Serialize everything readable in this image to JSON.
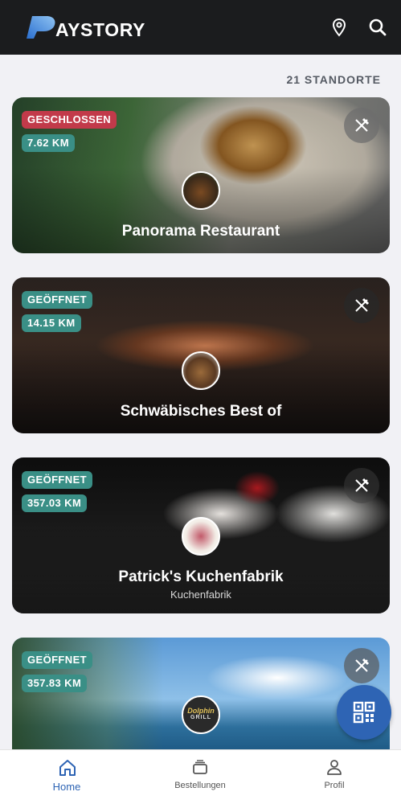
{
  "app": {
    "logo_text": "AYSTORY",
    "brand_color": "#3f86d8"
  },
  "header": {
    "icons": [
      "location-pin-icon",
      "search-icon"
    ]
  },
  "locations": {
    "count_label": "21 STANDORTE"
  },
  "cards": [
    {
      "status": "GESCHLOSSEN",
      "status_color": "#c23a4a",
      "distance": "7.62 KM",
      "title": "Panorama Restaurant",
      "subtitle": "",
      "icon": "knife-fork-icon"
    },
    {
      "status": "GEÖFFNET",
      "status_color": "#3a8f86",
      "distance": "14.15 KM",
      "title": "Schwäbisches Best of",
      "subtitle": "",
      "icon": "knife-fork-icon"
    },
    {
      "status": "GEÖFFNET",
      "status_color": "#3a8f86",
      "distance": "357.03 KM",
      "title": "Patrick's Kuchenfabrik",
      "subtitle": "Kuchenfabrik",
      "icon": "knife-fork-icon"
    },
    {
      "status": "GEÖFFNET",
      "status_color": "#3a8f86",
      "distance": "357.83 KM",
      "title": "",
      "subtitle": "",
      "icon": "knife-fork-icon",
      "avatar_text_top": "Dolphin",
      "avatar_text_bottom": "GRILL"
    }
  ],
  "fab": {
    "icon": "qr-code-icon"
  },
  "bottom_nav": [
    {
      "label": "Home",
      "icon": "home-icon",
      "active": true
    },
    {
      "label": "Bestellungen",
      "icon": "orders-icon",
      "active": false
    },
    {
      "label": "Profil",
      "icon": "profile-icon",
      "active": false
    }
  ]
}
